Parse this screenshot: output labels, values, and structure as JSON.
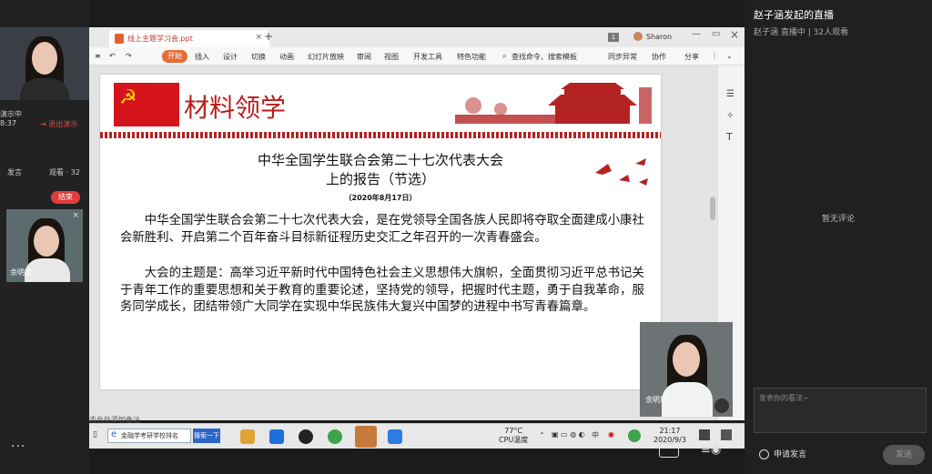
{
  "presenter": {
    "status": "演示中",
    "timer": "8:37",
    "end_share_label": "退出演示",
    "tab_speak": "发言",
    "tab_watch": "观看 · 32",
    "end_label": "结束",
    "participant_name": "余明思"
  },
  "wps": {
    "doc_tab_title": "线上主题学习会.ppt",
    "add_tab": "+",
    "user_badge": "1",
    "user_name": "Sharon",
    "ribbon": {
      "start": "开始",
      "items": [
        "插入",
        "设计",
        "切换",
        "动画",
        "幻灯片放映",
        "审阅",
        "视图",
        "开发工具",
        "特色功能"
      ],
      "search": "查找命令、搜索模板",
      "sync": "同步异常",
      "collab": "协作",
      "share": "分享"
    },
    "notes_hint": "击此处添加备注"
  },
  "slide": {
    "banner_title": "材料领学",
    "article_title_line1": "中华全国学生联合会第二十七次代表大会",
    "article_title_line2": "上的报告（节选）",
    "article_date": "（2020年8月17日）",
    "para1": "中华全国学生联合会第二十七次代表大会，是在党领导全国各族人民即将夺取全面建成小康社会新胜利、开启第二个百年奋斗目标新征程历史交汇之年召开的一次青春盛会。",
    "para2": "大会的主题是：高举习近平新时代中国特色社会主义思想伟大旗帜，全面贯彻习近平总书记关于青年工作的重要思想和关于教育的重要论述，坚持党的领导，把握时代主题，勇于自我革命，服务同学成长，团结带领广大同学在实现中华民族伟大复兴中国梦的进程中书写青春篇章。"
  },
  "cam_float_name": "余明思",
  "taskbar": {
    "search_text": "金融学考研学校排名",
    "search_btn": "搜索一下",
    "cpu_temp": "77°C",
    "cpu_label": "CPU温度",
    "ime": "中",
    "time": "21:17",
    "date": "2020/9/3"
  },
  "live": {
    "title": "赵子涵发起的直播",
    "subtitle": "赵子涵 直播中 | 32人观看",
    "no_comment": "暂无评论",
    "comment_placeholder": "发表你的看法~",
    "apply_label": "申请发言",
    "send_label": "发送"
  },
  "colors": {
    "accent_orange": "#e66b35",
    "slide_red": "#b91c1c",
    "end_red": "#e03c3c"
  }
}
